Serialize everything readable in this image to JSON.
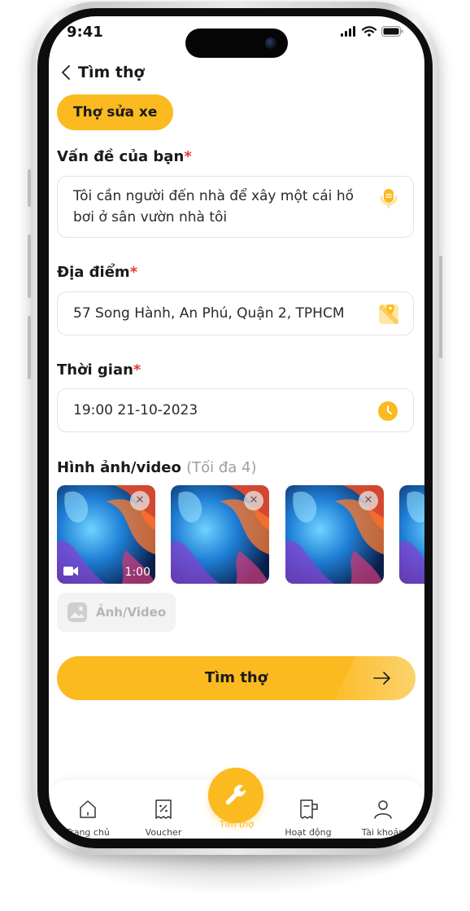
{
  "status": {
    "time": "9:41"
  },
  "header": {
    "title": "Tìm thợ"
  },
  "category_chip": "Thợ sửa xe",
  "problem": {
    "label": "Vấn đề của bạn",
    "required": "*",
    "line1": "Tôi cần người đến nhà để xây một cái hồ",
    "line2": "bơi ở sân vườn nhà tôi"
  },
  "location": {
    "label": "Địa điểm",
    "required": "*",
    "value": "57 Song Hành, An Phú, Quận 2,  TPHCM"
  },
  "time": {
    "label": "Thời gian",
    "required": "*",
    "value": "19:00  21-10-2023"
  },
  "media": {
    "label": "Hình ảnh/video",
    "hint": "(Tối đa 4)",
    "video_duration": "1:00",
    "remove_symbol": "✕",
    "add_label": "Ảnh/Video"
  },
  "cta": {
    "label": "Tìm thợ",
    "arrow": "→"
  },
  "nav": {
    "items": [
      {
        "label": "Trang chủ",
        "icon": "home-icon"
      },
      {
        "label": "Voucher",
        "icon": "voucher-icon"
      },
      {
        "label": "Tìm thợ",
        "icon": "wrench-icon",
        "active": true
      },
      {
        "label": "Hoạt động",
        "icon": "activity-icon"
      },
      {
        "label": "Tài khoản",
        "icon": "user-icon"
      }
    ]
  },
  "colors": {
    "accent": "#fbba1f",
    "required": "#e53935",
    "text": "#1a1a1a",
    "muted": "#9e9e9e"
  }
}
